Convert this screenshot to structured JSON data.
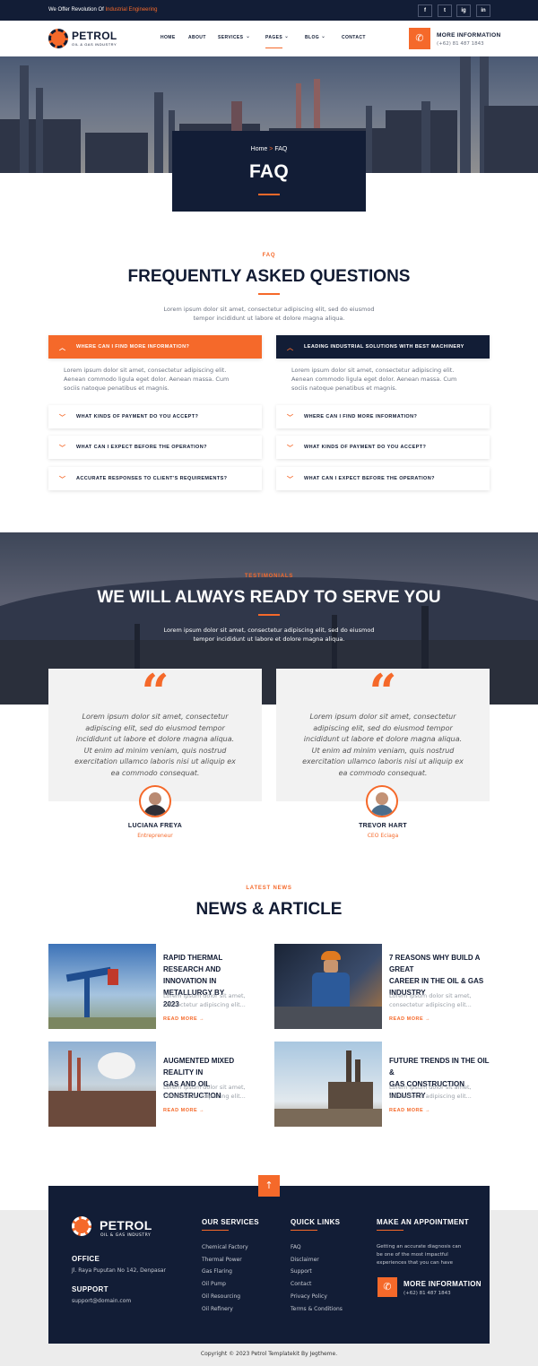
{
  "topbar": {
    "text_prefix": "We Offer Revolution Of",
    "text_highlight": "Industrial Engineering",
    "socials": [
      "f",
      "t",
      "ig",
      "in"
    ]
  },
  "brand": {
    "name": "PETROL",
    "tagline": "OIL & GAS INDUSTRY"
  },
  "nav": {
    "items": [
      "HOME",
      "ABOUT",
      "SERVICES",
      "PAGES",
      "BLOG",
      "CONTACT"
    ],
    "contact_title": "MORE INFORMATION",
    "contact_phone": "(+62) 81 487 1843"
  },
  "hero": {
    "breadcrumb_home": "Home",
    "breadcrumb_sep": ">",
    "breadcrumb_current": "FAQ",
    "title": "FAQ"
  },
  "faq": {
    "subtitle": "FAQ",
    "title": "FREQUENTLY ASKED QUESTIONS",
    "intro_1": "Lorem ipsum dolor sit amet, consectetur adipiscing elit, sed do eiusmod",
    "intro_2": "tempor incididunt ut labore et dolore magna aliqua.",
    "left": [
      {
        "q": "WHERE CAN I FIND MORE INFORMATION?",
        "a_1": "Lorem ipsum dolor sit amet, consectetur adipiscing elit.",
        "a_2": "Aenean commodo ligula eget dolor. Aenean massa. Cum",
        "a_3": "sociis natoque penatibus et magnis."
      },
      {
        "q": "WHAT KINDS OF PAYMENT DO YOU ACCEPT?"
      },
      {
        "q": "WHAT CAN I EXPECT BEFORE THE OPERATION?"
      },
      {
        "q": "ACCURATE RESPONSES TO CLIENT'S REQUIREMENTS?"
      }
    ],
    "right": [
      {
        "q": "LEADING INDUSTRIAL SOLUTIONS WITH BEST MACHINERY",
        "a_1": "Lorem ipsum dolor sit amet, consectetur adipiscing elit.",
        "a_2": "Aenean commodo ligula eget dolor. Aenean massa. Cum",
        "a_3": "sociis natoque penatibus et magnis."
      },
      {
        "q": "WHERE CAN I FIND MORE INFORMATION?"
      },
      {
        "q": "WHAT KINDS OF PAYMENT DO YOU ACCEPT?"
      },
      {
        "q": "WHAT CAN I EXPECT BEFORE THE OPERATION?"
      }
    ]
  },
  "testimonials": {
    "subtitle": "TESTIMONIALS",
    "title": "WE WILL ALWAYS READY TO SERVE YOU",
    "intro_1": "Lorem ipsum dolor sit amet, consectetur adipiscing elit, sed do eiusmod",
    "intro_2": "tempor incididunt ut labore et dolore magna aliqua.",
    "quote_mark": "“",
    "items": [
      {
        "l1": "Lorem ipsum dolor sit amet, consectetur",
        "l2": "adipiscing elit, sed do eiusmod tempor",
        "l3": "incididunt ut labore et dolore magna aliqua.",
        "l4": "Ut enim ad minim veniam, quis nostrud",
        "l5": "exercitation ullamco laboris nisi ut aliquip ex",
        "l6": "ea commodo consequat.",
        "name": "LUCIANA FREYA",
        "role": "Entrepreneur"
      },
      {
        "l1": "Lorem ipsum dolor sit amet, consectetur",
        "l2": "adipiscing elit, sed do eiusmod tempor",
        "l3": "incididunt ut labore et dolore magna aliqua.",
        "l4": "Ut enim ad minim veniam, quis nostrud",
        "l5": "exercitation ullamco laboris nisi ut aliquip ex",
        "l6": "ea commodo consequat.",
        "name": "TREVOR HART",
        "role": "CEO Eciaga"
      }
    ]
  },
  "news": {
    "subtitle": "LATEST NEWS",
    "title": "NEWS & ARTICLE",
    "read_more": "READ MORE",
    "items": [
      {
        "t1": "RAPID THERMAL RESEARCH AND",
        "t2": "INNOVATION IN METALLURGY BY",
        "t3": "2023",
        "x1": "Lorem ipsum dolor sit amet,",
        "x2": "consectetur adipiscing elit..."
      },
      {
        "t1": "7 REASONS WHY BUILD A GREAT",
        "t2": "CAREER IN THE OIL & GAS",
        "t3": "INDUSTRY",
        "x1": "Lorem ipsum dolor sit amet,",
        "x2": "consectetur adipiscing elit..."
      },
      {
        "t1": "AUGMENTED MIXED REALITY IN",
        "t2": "GAS AND OIL CONSTRUCTION",
        "t3": "",
        "x1": "Lorem ipsum dolor sit amet,",
        "x2": "consectetur adipiscing elit..."
      },
      {
        "t1": "FUTURE TRENDS IN THE OIL &",
        "t2": "GAS CONSTRUCTION INDUSTRY",
        "t3": "",
        "x1": "Lorem ipsum dolor sit amet,",
        "x2": "consectetur adipiscing elit..."
      }
    ]
  },
  "footer": {
    "office_title": "OFFICE",
    "office_address": "Jl. Raya Puputan No 142, Denpasar",
    "support_title": "SUPPORT",
    "support_email": "support@domain.com",
    "services_title": "OUR SERVICES",
    "services": [
      "Chemical Factory",
      "Thermal Power",
      "Gas Flaring",
      "Oil Pump",
      "Oil Resourcing",
      "Oil Refinery"
    ],
    "links_title": "QUICK LINKS",
    "links": [
      "FAQ",
      "Disclaimer",
      "Support",
      "Contact",
      "Privacy Policy",
      "Terms & Conditions"
    ],
    "appt_title": "MAKE AN APPOINTMENT",
    "appt_1": "Getting an accurate diagnosis can",
    "appt_2": "be one of the most impactful",
    "appt_3": "experiences that you can have",
    "info_title": "MORE INFORMATION",
    "info_phone": "(+62) 81 487 1843",
    "copyright": "Copyright © 2023 Petrol Templatekit By Jegtheme."
  },
  "colors": {
    "navy": "#121d36",
    "orange": "#f5692a"
  },
  "icons": [
    "phone-icon",
    "chevron-up-icon",
    "chevron-down-icon",
    "arrow-right-icon",
    "arrow-up-icon",
    "gear-logo-icon"
  ]
}
